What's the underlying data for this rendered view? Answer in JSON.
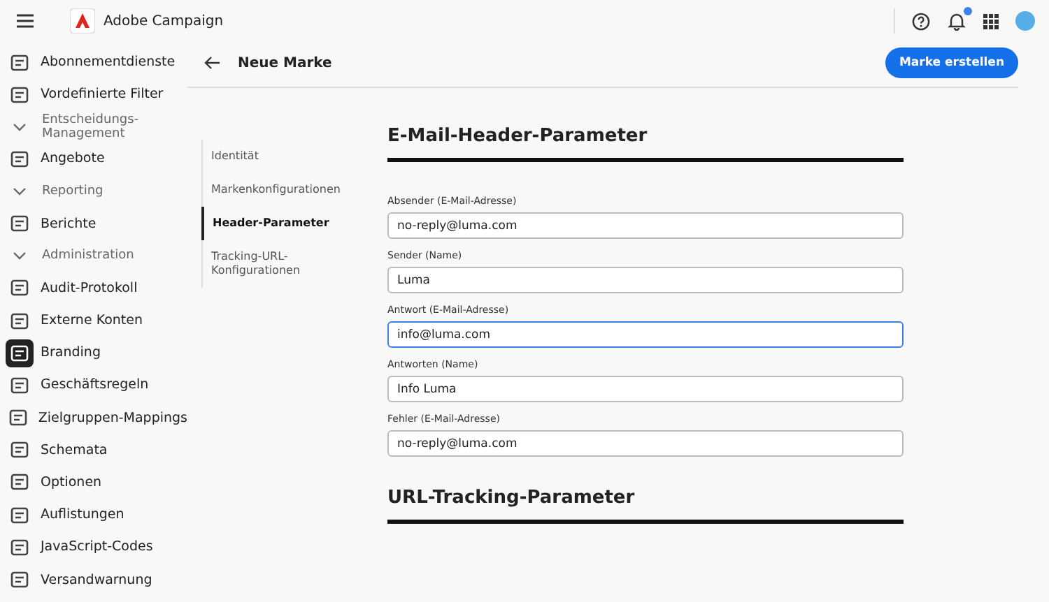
{
  "app": {
    "title": "Adobe Campaign",
    "notification_badge": true
  },
  "sidebar": {
    "items": [
      {
        "kind": "item",
        "label": "Abonnementdienste",
        "selected": false
      },
      {
        "kind": "item",
        "label": "Vordefinierte Filter",
        "selected": false
      },
      {
        "kind": "section",
        "label": "Entscheidungs-Management",
        "expanded": false
      },
      {
        "kind": "item",
        "label": "Angebote",
        "selected": false
      },
      {
        "kind": "section",
        "label": "Reporting",
        "expanded": false
      },
      {
        "kind": "item",
        "label": "Berichte",
        "selected": false
      },
      {
        "kind": "section",
        "label": "Administration",
        "expanded": false
      },
      {
        "kind": "item",
        "label": "Audit-Protokoll",
        "selected": false
      },
      {
        "kind": "item",
        "label": "Externe Konten",
        "selected": false
      },
      {
        "kind": "item",
        "label": "Branding",
        "selected": true
      },
      {
        "kind": "item",
        "label": "Geschäftsregeln",
        "selected": false
      },
      {
        "kind": "item",
        "label": "Zielgruppen-Mappings",
        "selected": false
      },
      {
        "kind": "item",
        "label": "Schemata",
        "selected": false
      },
      {
        "kind": "item",
        "label": "Optionen",
        "selected": false
      },
      {
        "kind": "item",
        "label": "Auflistungen",
        "selected": false
      },
      {
        "kind": "item",
        "label": "JavaScript-Codes",
        "selected": false
      },
      {
        "kind": "item",
        "label": "Versandwarnung",
        "selected": false
      }
    ]
  },
  "page": {
    "title": "Neue Marke",
    "primary_button": "Marke erstellen"
  },
  "steps": [
    {
      "label": "Identität",
      "selected": false
    },
    {
      "label": "Markenkonfigurationen",
      "selected": false
    },
    {
      "label": "Header-Parameter",
      "selected": true
    },
    {
      "label": "Tracking-URL-Konfigurationen",
      "selected": false
    }
  ],
  "sections": [
    {
      "title": "E-Mail-Header-Parameter",
      "fields": [
        {
          "label": "Absender (E-Mail-Adresse)",
          "value": "no-reply@luma.com",
          "focused": false
        },
        {
          "label": "Sender (Name)",
          "value": "Luma",
          "focused": false
        },
        {
          "label": "Antwort (E-Mail-Adresse)",
          "value": "info@luma.com",
          "focused": true
        },
        {
          "label": "Antworten (Name)",
          "value": "Info Luma",
          "focused": false
        },
        {
          "label": "Fehler (E-Mail-Adresse)",
          "value": "no-reply@luma.com",
          "focused": false
        }
      ]
    },
    {
      "title": "URL-Tracking-Parameter"
    }
  ]
}
